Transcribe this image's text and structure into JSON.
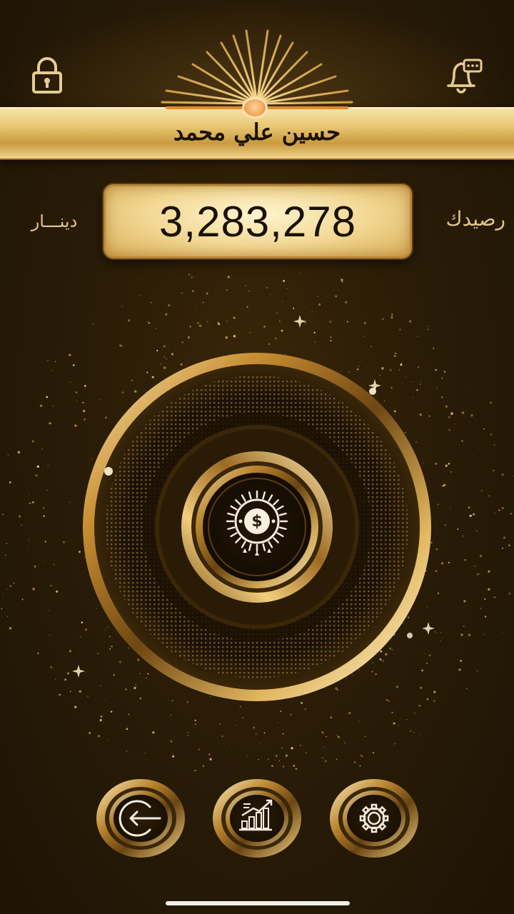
{
  "header": {
    "user_name": "حسين علي محمد",
    "lock_icon": "lock-icon",
    "notification_icon": "bell-chat-icon"
  },
  "balance": {
    "label": "رصيدك",
    "value": "3,283,278",
    "currency": "دينـــار"
  },
  "main_button": {
    "icon": "dollar-sun-coin-icon"
  },
  "bottom_nav": [
    {
      "id": "logout",
      "icon": "logout-arrow-icon"
    },
    {
      "id": "stats",
      "icon": "growth-chart-icon"
    },
    {
      "id": "settings",
      "icon": "gear-icon"
    }
  ],
  "colors": {
    "background": "#2a1c07",
    "gold": "#d9ae58",
    "gold_light": "#f6e3a8",
    "accent_orange": "#e98a2a",
    "text_gold": "#e2c58a"
  }
}
